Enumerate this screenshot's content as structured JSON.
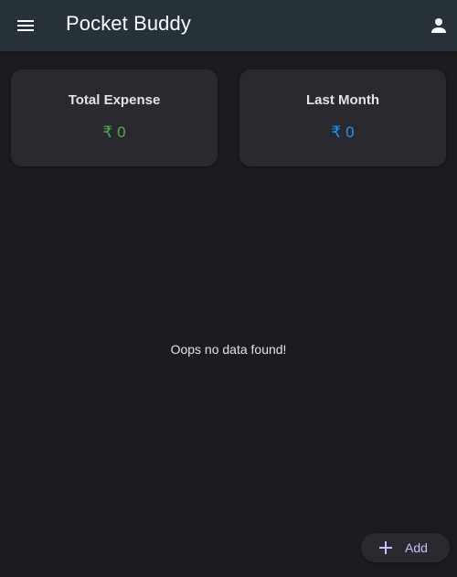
{
  "app_bar": {
    "title": "Pocket Buddy",
    "menu_icon": "menu-icon",
    "account_icon": "account-icon"
  },
  "summary_cards": [
    {
      "title": "Total Expense",
      "currency": "₹",
      "value": "0",
      "color": "#4caf50"
    },
    {
      "title": "Last Month",
      "currency": "₹",
      "value": "0",
      "color": "#2196f3"
    }
  ],
  "empty_state": {
    "message": "Oops no data found!"
  },
  "fab": {
    "icon": "plus-icon",
    "label": "Add"
  },
  "colors": {
    "background": "#1c1b1f",
    "app_bar": "#263238",
    "card": "#2b2930",
    "accent": "#cfbcff"
  }
}
